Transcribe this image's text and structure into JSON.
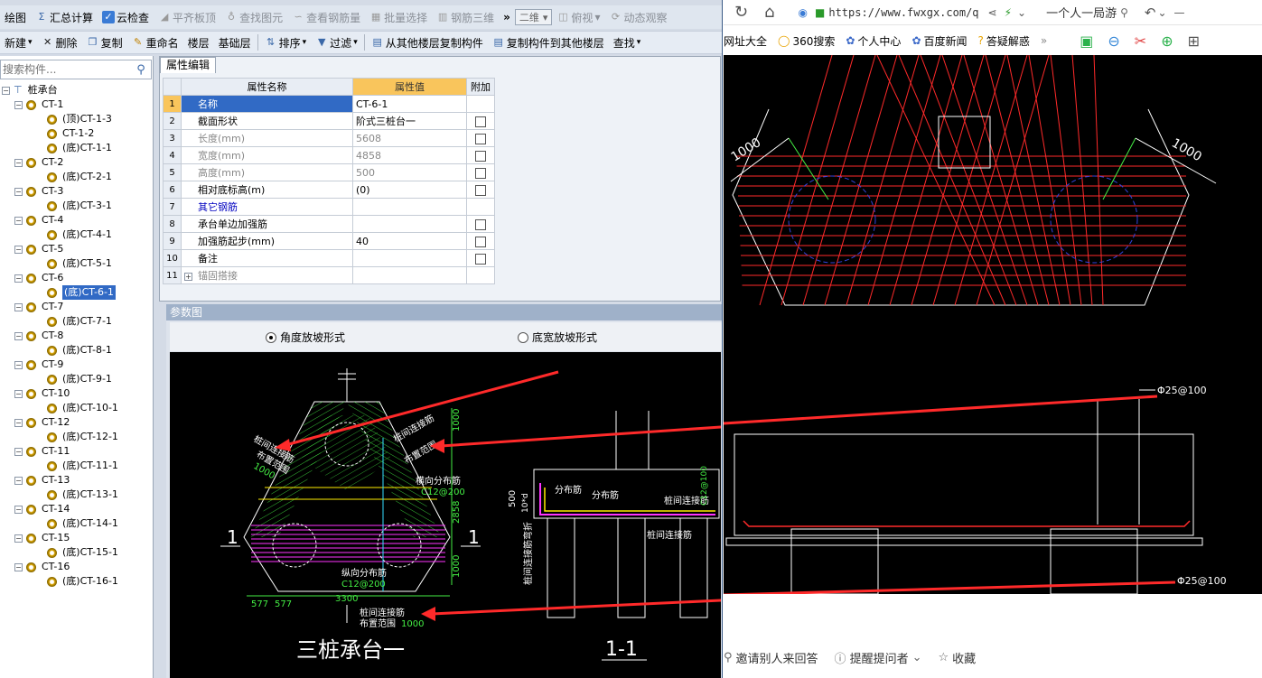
{
  "app": {
    "toolbar1": {
      "items": [
        {
          "label": "绘图",
          "disabled": false
        },
        {
          "label": "汇总计算",
          "disabled": false
        },
        {
          "label": "云检查",
          "disabled": false
        },
        {
          "label": "平齐板顶",
          "disabled": true
        },
        {
          "label": "查找图元",
          "disabled": true
        },
        {
          "label": "查看钢筋量",
          "disabled": true
        },
        {
          "label": "批量选择",
          "disabled": true
        },
        {
          "label": "钢筋三维",
          "disabled": true
        }
      ],
      "view_select": "二维",
      "view_mode": "俯视",
      "dynamic_view": "动态观察"
    },
    "toolbar2": {
      "new_label": "新建",
      "delete_label": "删除",
      "copy_label": "复制",
      "rename_label": "重命名",
      "floor_label": "楼层",
      "floor_value": "基础层",
      "sort_label": "排序",
      "filter_label": "过滤",
      "copy_from_label": "从其他楼层复制构件",
      "copy_to_label": "复制构件到其他楼层",
      "find_label": "查找"
    },
    "tree": {
      "search_placeholder": "搜索构件...",
      "root": "桩承台",
      "groups": [
        {
          "name": "CT-1",
          "children": [
            "(顶)CT-1-3",
            "CT-1-2",
            "(底)CT-1-1"
          ]
        },
        {
          "name": "CT-2",
          "children": [
            "(底)CT-2-1"
          ]
        },
        {
          "name": "CT-3",
          "children": [
            "(底)CT-3-1"
          ]
        },
        {
          "name": "CT-4",
          "children": [
            "(底)CT-4-1"
          ]
        },
        {
          "name": "CT-5",
          "children": [
            "(底)CT-5-1"
          ]
        },
        {
          "name": "CT-6",
          "children": [
            "(底)CT-6-1"
          ]
        },
        {
          "name": "CT-7",
          "children": [
            "(底)CT-7-1"
          ]
        },
        {
          "name": "CT-8",
          "children": [
            "(底)CT-8-1"
          ]
        },
        {
          "name": "CT-9",
          "children": [
            "(底)CT-9-1"
          ]
        },
        {
          "name": "CT-10",
          "children": [
            "(底)CT-10-1"
          ]
        },
        {
          "name": "CT-12",
          "children": [
            "(底)CT-12-1"
          ]
        },
        {
          "name": "CT-11",
          "children": [
            "(底)CT-11-1"
          ]
        },
        {
          "name": "CT-13",
          "children": [
            "(底)CT-13-1"
          ]
        },
        {
          "name": "CT-14",
          "children": [
            "(底)CT-14-1"
          ]
        },
        {
          "name": "CT-15",
          "children": [
            "(底)CT-15-1"
          ]
        },
        {
          "name": "CT-16",
          "children": [
            "(底)CT-16-1"
          ]
        }
      ],
      "selected": "(底)CT-6-1"
    },
    "props": {
      "tab": "属性编辑",
      "headers": [
        "属性名称",
        "属性值",
        "附加"
      ],
      "rows": [
        {
          "no": "1",
          "name": "名称",
          "value": "CT-6-1",
          "check": false,
          "style": "selected"
        },
        {
          "no": "2",
          "name": "截面形状",
          "value": "阶式三桩台一",
          "check": true,
          "style": ""
        },
        {
          "no": "3",
          "name": "长度(mm)",
          "value": "5608",
          "check": true,
          "style": "gray"
        },
        {
          "no": "4",
          "name": "宽度(mm)",
          "value": "4858",
          "check": true,
          "style": "gray"
        },
        {
          "no": "5",
          "name": "高度(mm)",
          "value": "500",
          "check": true,
          "style": "gray"
        },
        {
          "no": "6",
          "name": "相对底标高(m)",
          "value": "(0)",
          "check": true,
          "style": ""
        },
        {
          "no": "7",
          "name": "其它钢筋",
          "value": "",
          "check": false,
          "style": "blue"
        },
        {
          "no": "8",
          "name": "承台单边加强筋",
          "value": "",
          "check": true,
          "style": ""
        },
        {
          "no": "9",
          "name": "加强筋起步(mm)",
          "value": "40",
          "check": true,
          "style": ""
        },
        {
          "no": "10",
          "name": "备注",
          "value": "",
          "check": true,
          "style": ""
        },
        {
          "no": "11",
          "name": "锚固搭接",
          "value": "",
          "check": false,
          "style": "gray",
          "expandable": true
        }
      ]
    },
    "param": {
      "title": "参数图",
      "radio_angle": "角度放坡形式",
      "radio_width": "底宽放坡形式",
      "selected_radio": "angle"
    },
    "cad": {
      "title_plan": "三桩承台一",
      "title_section": "1-1",
      "mark_1": "1",
      "labels": {
        "pile_bar": "桩间连接筋",
        "pile_bar_code": "C12@100",
        "dist_range": "布置范围",
        "dist_range_val": "1000",
        "transverse": "横向分布筋",
        "transverse_code": "C12@200",
        "longitudinal": "纵向分布筋",
        "longitudinal_code": "C12@200",
        "distribution": "分布筋",
        "pile_bar_bend": "桩间连接筋弯折",
        "dim_1000": "1000",
        "dim_2858": "2858",
        "dim_3300": "3300",
        "dim_577": "577",
        "dim_500": "500",
        "dim_10d": "10*d",
        "dim_10d_code": "C12@100"
      }
    }
  },
  "browser": {
    "url": "https://www.fwxgx.com/q",
    "search_text": "一个人一局游",
    "bookmarks": [
      "网址大全",
      "360搜索",
      "个人中心",
      "百度新闻",
      "答疑解惑"
    ],
    "cad": {
      "dim_left": "1000",
      "dim_right": "1000",
      "bar_top": "Φ25@100",
      "bar_bottom": "Φ25@100"
    },
    "footer": {
      "invite": "邀请别人来回答",
      "remind": "提醒提问者",
      "collect": "收藏"
    }
  },
  "colors": {
    "accent": "#316ac5",
    "highlight_header": "#f9c55c",
    "cad_red": "#ff2a2a",
    "cad_green": "#44ee44",
    "cad_yellow": "#ffee00",
    "cad_magenta": "#ff33ff"
  }
}
